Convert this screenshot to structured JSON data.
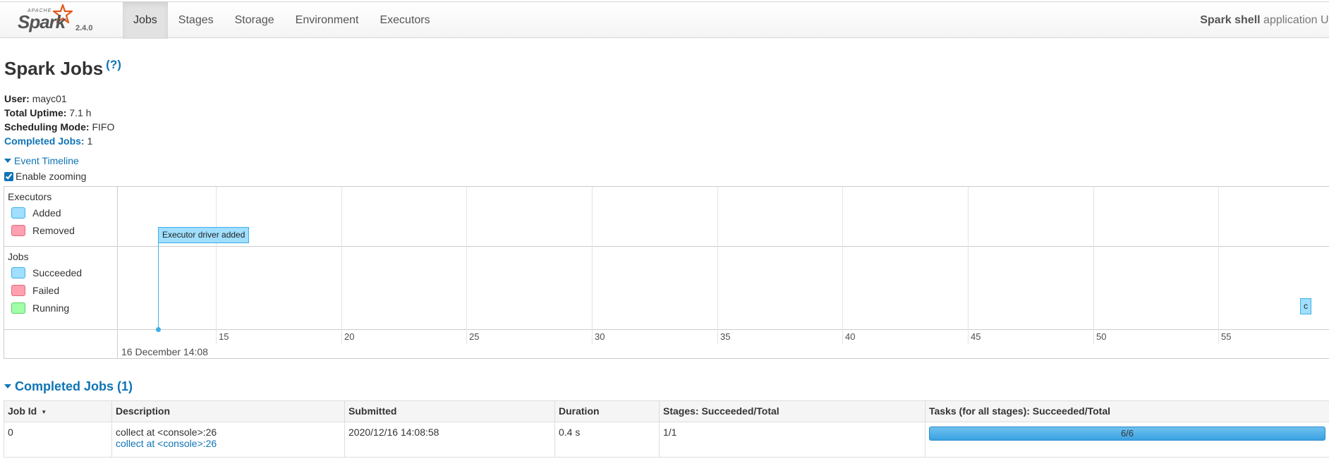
{
  "navbar": {
    "apache": "APACHE",
    "brand": "Spark",
    "version": "2.4.0",
    "tabs": [
      "Jobs",
      "Stages",
      "Storage",
      "Environment",
      "Executors"
    ],
    "active_tab": "Jobs",
    "app_name": "Spark shell",
    "app_suffix": "application UI"
  },
  "page": {
    "title": "Spark Jobs",
    "help": "(?)"
  },
  "summary": {
    "user_label": "User:",
    "user": "mayc01",
    "uptime_label": "Total Uptime:",
    "uptime": "7.1 h",
    "mode_label": "Scheduling Mode:",
    "mode": "FIFO",
    "completed_label": "Completed Jobs:",
    "completed": "1"
  },
  "event_timeline": {
    "label": "Event Timeline",
    "enable_zooming_label": "Enable zooming",
    "enable_zooming": true,
    "executors_title": "Executors",
    "executor_legend": [
      "Added",
      "Removed"
    ],
    "jobs_title": "Jobs",
    "job_legend": [
      "Succeeded",
      "Failed",
      "Running"
    ],
    "ticks": [
      "15",
      "20",
      "25",
      "30",
      "35",
      "40",
      "45",
      "50",
      "55"
    ],
    "date_label": "16 December 14:08",
    "executor_event": "Executor driver added",
    "job_event": "c",
    "colors": {
      "added": "#a0dfff",
      "removed": "#ffa1b0",
      "succeeded": "#a0dfff",
      "failed": "#ffa1b0",
      "running": "#a0ffa7"
    }
  },
  "completed_jobs": {
    "title": "Completed Jobs (1)",
    "columns": [
      "Job Id",
      "Description",
      "Submitted",
      "Duration",
      "Stages: Succeeded/Total",
      "Tasks (for all stages): Succeeded/Total"
    ],
    "rows": [
      {
        "job_id": "0",
        "description": "collect at <console>:26",
        "description_link": "collect at <console>:26",
        "submitted": "2020/12/16 14:08:58",
        "duration": "0.4 s",
        "stages": "1/1",
        "tasks": "6/6",
        "tasks_fraction": 1.0
      }
    ]
  }
}
